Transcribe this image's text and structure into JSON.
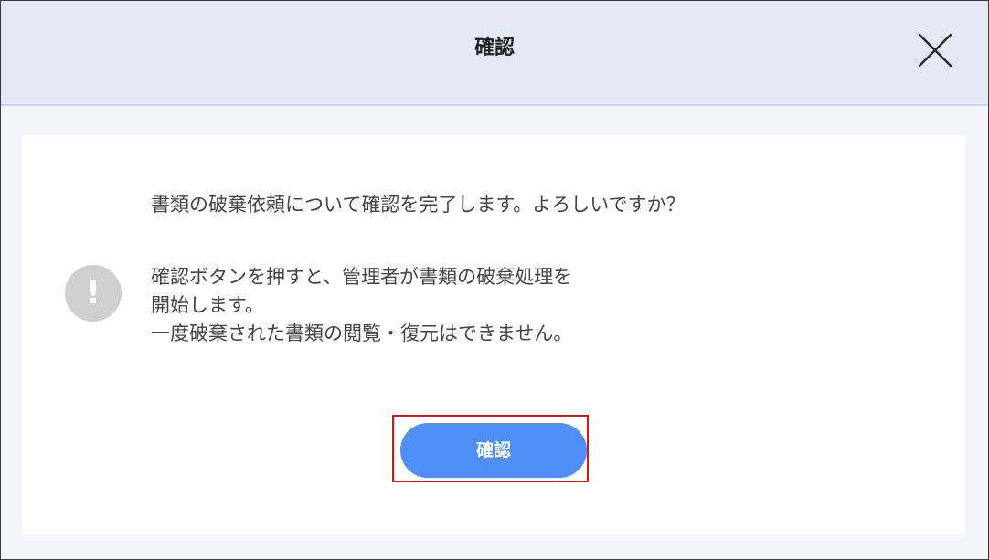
{
  "dialog": {
    "title": "確認",
    "close_icon": "close-icon"
  },
  "body": {
    "question": "書類の破棄依頼について確認を完了します。よろしいですか？",
    "notice_icon": "exclamation-icon",
    "notice_icon_glyph": "!",
    "notice_lines": [
      "確認ボタンを押すと、管理者が書類の破棄処理を",
      "開始します。",
      "一度破棄された書類の閲覧・復元はできません。"
    ],
    "confirm_label": "確認"
  },
  "colors": {
    "header_bg": "#e4e9f7",
    "button_bg": "#4f8ff7",
    "highlight_border": "#d9141b",
    "icon_bg": "#cfcfcf"
  }
}
